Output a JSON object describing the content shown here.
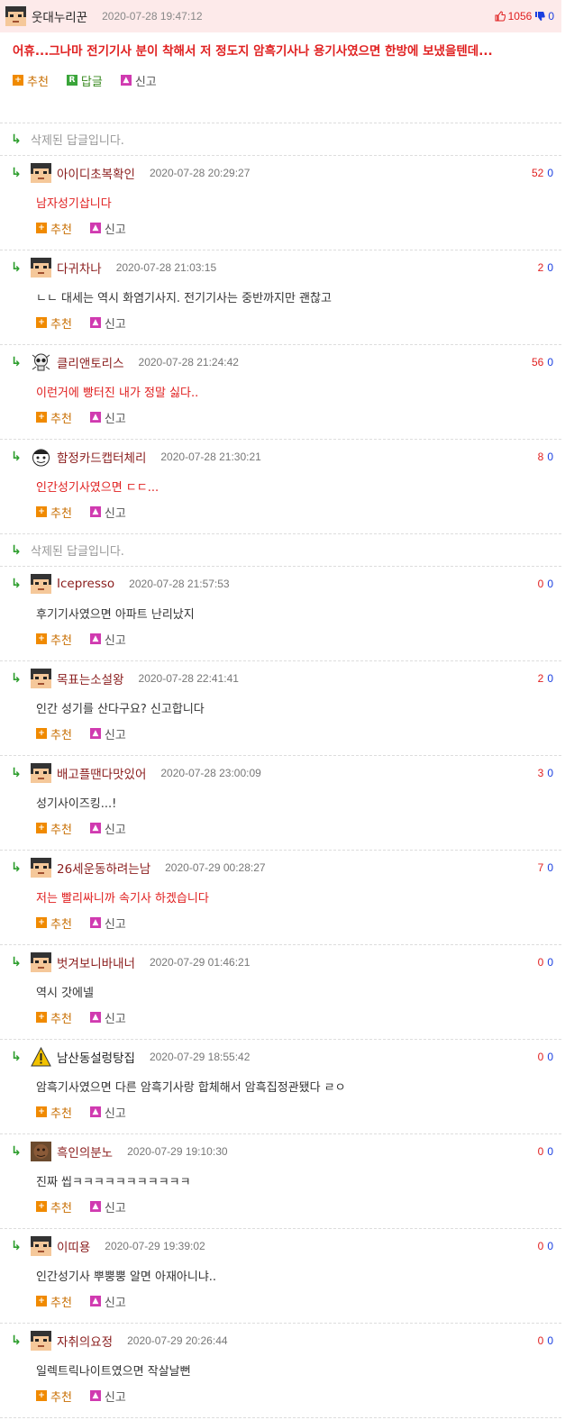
{
  "best": {
    "nick": "웃대누리꾼",
    "date": "2020-07-28 19:47:12",
    "up": "1056",
    "down": "0",
    "body": "어휴...그나마 전기기사 분이 착해서 저 정도지 암흑기사나 용기사였으면 한방에 보냈을텐데...",
    "actions": {
      "recommend": "추천",
      "reply": "답글",
      "report": "신고"
    }
  },
  "labels": {
    "recommend": "추천",
    "report": "신고"
  },
  "deleted_text": "삭제된 답글입니다.",
  "colors": {
    "red": "#e02020",
    "blue": "#1a3fe0",
    "green_arrow": "#2e9e2e",
    "best_bg": "#fdeaea"
  },
  "rows": [
    {
      "type": "deleted"
    },
    {
      "type": "reply",
      "nick": "아이디초복확인",
      "date": "2020-07-28 20:29:27",
      "up": "52",
      "down": "0",
      "body": "남자성기삽니다",
      "red": true,
      "avatar": "default-avatar"
    },
    {
      "type": "reply",
      "nick": "다귀차나",
      "date": "2020-07-28 21:03:15",
      "up": "2",
      "down": "0",
      "body": "ㄴㄴ 대세는 역시 화염기사지. 전기기사는 중반까지만 괜찮고",
      "red": false,
      "avatar": "default-avatar"
    },
    {
      "type": "reply",
      "nick": "클리앤토리스",
      "date": "2020-07-28 21:24:42",
      "up": "56",
      "down": "0",
      "body": "이런거에 빵터진 내가 정말 싫다..",
      "red": true,
      "avatar": "skull-avatar"
    },
    {
      "type": "reply",
      "nick": "함정카드캡터체리",
      "date": "2020-07-28 21:30:21",
      "up": "8",
      "down": "0",
      "body": "인간성기사였으면 ㄷㄷ...",
      "red": true,
      "avatar": "cartoon-face-avatar"
    },
    {
      "type": "deleted"
    },
    {
      "type": "reply",
      "nick": "Icepresso",
      "date": "2020-07-28 21:57:53",
      "up": "0",
      "down": "0",
      "body": "후기기사였으면 아파트 난리났지",
      "red": false,
      "avatar": "default-avatar"
    },
    {
      "type": "reply",
      "nick": "목표는소설왕",
      "date": "2020-07-28 22:41:41",
      "up": "2",
      "down": "0",
      "body": "인간 성기를 산다구요? 신고합니다",
      "red": false,
      "avatar": "default-avatar"
    },
    {
      "type": "reply",
      "nick": "배고플땐다맛있어",
      "date": "2020-07-28 23:00:09",
      "up": "3",
      "down": "0",
      "body": "성기사이즈킹...!",
      "red": false,
      "avatar": "default-avatar"
    },
    {
      "type": "reply",
      "nick": "26세운동하려는남",
      "date": "2020-07-29 00:28:27",
      "up": "7",
      "down": "0",
      "body": "저는 빨리싸니까 속기사 하겠습니다",
      "red": true,
      "avatar": "default-avatar"
    },
    {
      "type": "reply",
      "nick": "벗겨보니바내너",
      "date": "2020-07-29 01:46:21",
      "up": "0",
      "down": "0",
      "body": "역시 갓에넬",
      "red": false,
      "avatar": "default-avatar"
    },
    {
      "type": "reply",
      "nick": "남산동설렁탕집",
      "date": "2020-07-29 18:55:42",
      "up": "0",
      "down": "0",
      "body": "암흑기사였으면 다른 암흑기사랑 합체해서 암흑집정관됐다 ㄹㅇ",
      "red": false,
      "avatar": "warning-sign-avatar",
      "nick_black": true
    },
    {
      "type": "reply",
      "nick": "흑인의분노",
      "date": "2020-07-29 19:10:30",
      "up": "0",
      "down": "0",
      "body": "진짜 씹ㅋㅋㅋㅋㅋㅋㅋㅋㅋㅋㅋ",
      "red": false,
      "avatar": "photo-avatar"
    },
    {
      "type": "reply",
      "nick": "이띠용",
      "date": "2020-07-29 19:39:02",
      "up": "0",
      "down": "0",
      "body": "인간성기사 뿌뿡뿡 알면 아재아니냐..",
      "red": false,
      "avatar": "default-avatar"
    },
    {
      "type": "reply",
      "nick": "자취의요정",
      "date": "2020-07-29 20:26:44",
      "up": "0",
      "down": "0",
      "body": "일렉트릭나이트였으면 작살날뻔",
      "red": false,
      "avatar": "default-avatar"
    }
  ]
}
